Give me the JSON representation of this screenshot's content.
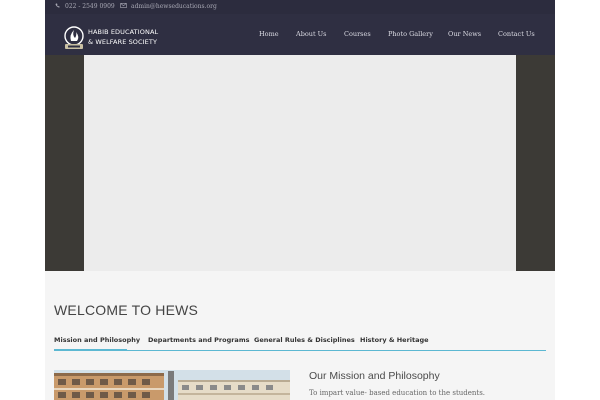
{
  "topbar": {
    "phone": "022 - 2549 0909",
    "email": "admin@hewseducations.org",
    "phone_icon": "phone-icon",
    "email_icon": "envelope-icon"
  },
  "logo": {
    "line1": "HABIB EDUCATIONAL",
    "line2": "& WELFARE  SOCIETY",
    "icon": "society-logo-emblem"
  },
  "nav": {
    "items": [
      {
        "label": "Home"
      },
      {
        "label": "About Us"
      },
      {
        "label": "Courses"
      },
      {
        "label": "Photo Gallery"
      },
      {
        "label": "Our News"
      },
      {
        "label": "Contact Us"
      }
    ]
  },
  "welcome": {
    "title": "WELCOME TO HEWS"
  },
  "tabs": [
    {
      "label": "Mission and Philosophy",
      "active": true
    },
    {
      "label": "Departments and Programs",
      "active": false
    },
    {
      "label": "General Rules & Disciplines",
      "active": false
    },
    {
      "label": "History & Heritage",
      "active": false
    }
  ],
  "mission": {
    "title": "Our Mission and Philosophy",
    "text": "To impart value- based education to the students."
  },
  "colors": {
    "topbar_bg": "#2c2c3e",
    "nav_bg": "#2f2f42",
    "hero_bg": "#3c3a36",
    "accent": "#5cb8d2"
  }
}
